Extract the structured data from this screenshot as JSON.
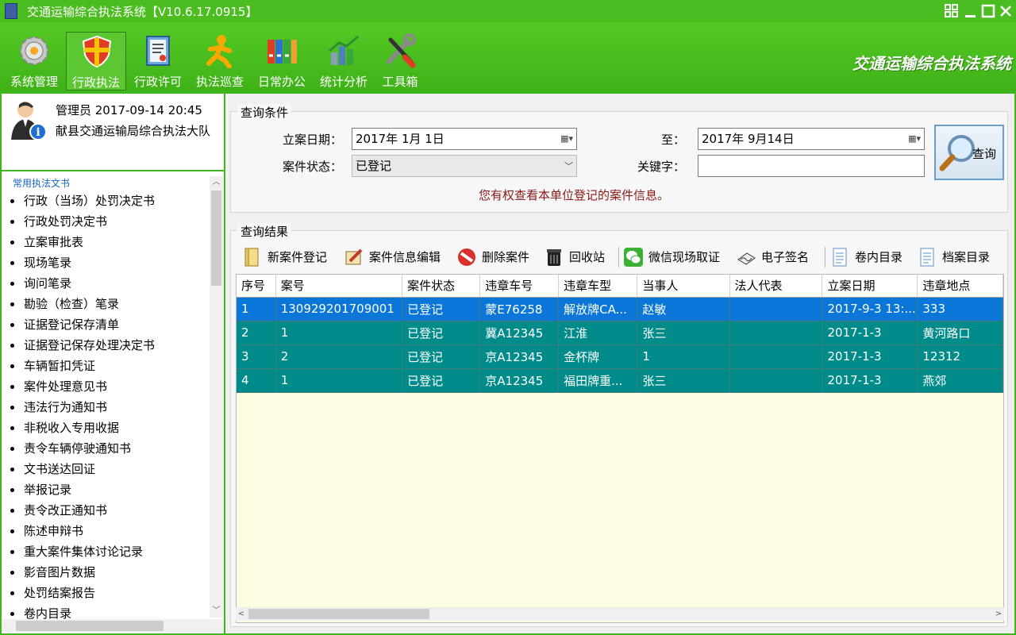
{
  "window": {
    "title": "交通运输综合执法系统【V10.6.17.0915】"
  },
  "ribbon": {
    "brand": "交通运输综合执法系统",
    "items": [
      {
        "label": "系统管理",
        "icon": "gear-icon"
      },
      {
        "label": "行政执法",
        "icon": "shield-icon",
        "active": true
      },
      {
        "label": "行政许可",
        "icon": "document-icon"
      },
      {
        "label": "执法巡查",
        "icon": "runner-icon"
      },
      {
        "label": "日常办公",
        "icon": "binders-icon"
      },
      {
        "label": "统计分析",
        "icon": "chart-icon"
      },
      {
        "label": "工具箱",
        "icon": "tools-icon"
      }
    ]
  },
  "user": {
    "role_datetime": "管理员   2017-09-14 20:45",
    "org": "献县交通运输局综合执法大队"
  },
  "sidebar": {
    "header": "常用执法文书",
    "items": [
      "行政（当场）处罚决定书",
      "行政处罚决定书",
      "立案审批表",
      "现场笔录",
      "询问笔录",
      "勘验（检查）笔录",
      "证据登记保存清单",
      "证据登记保存处理决定书",
      "车辆暂扣凭证",
      "案件处理意见书",
      "违法行为通知书",
      "非税收入专用收据",
      "责令车辆停驶通知书",
      "文书送达回证",
      "举报记录",
      "责令改正通知书",
      "陈述申辩书",
      "重大案件集体讨论记录",
      "影音图片数据",
      "处罚结案报告",
      "卷内目录"
    ]
  },
  "query": {
    "title": "查询条件",
    "date_label": "立案日期：",
    "date_from": "2017年  1月  1日",
    "to_label": "至：",
    "date_to": "2017年  9月14日",
    "status_label": "案件状态：",
    "status_value": "已登记",
    "keyword_label": "关键字：",
    "keyword_value": "",
    "notice": "您有权查看本单位登记的案件信息。",
    "search_label": "查询"
  },
  "results": {
    "title": "查询结果",
    "toolbar": [
      {
        "label": "新案件登记",
        "icon": "folder-icon"
      },
      {
        "label": "案件信息编辑",
        "icon": "edit-icon"
      },
      {
        "label": "删除案件",
        "icon": "delete-icon"
      },
      {
        "label": "回收站",
        "icon": "trash-icon"
      },
      {
        "label": "微信现场取证",
        "icon": "wechat-icon"
      },
      {
        "label": "电子签名",
        "icon": "signature-icon"
      },
      {
        "label": "卷内目录",
        "icon": "doc-list-icon"
      },
      {
        "label": "档案目录",
        "icon": "archive-icon"
      }
    ],
    "columns": [
      "序号",
      "案号",
      "案件状态",
      "违章车号",
      "违章车型",
      "当事人",
      "法人代表",
      "立案日期",
      "违章地点"
    ],
    "rows": [
      [
        "1",
        "130929201709001",
        "已登记",
        "蒙E76258",
        "解放牌CA...",
        "赵敏",
        "",
        "2017-9-3 13:...",
        "333"
      ],
      [
        "2",
        "1",
        "已登记",
        "冀A12345",
        "江淮",
        "张三",
        "",
        "2017-1-3",
        "黄河路口"
      ],
      [
        "3",
        "2",
        "已登记",
        "京A12345",
        "金杯牌",
        "1",
        "",
        "2017-1-3",
        "12312"
      ],
      [
        "4",
        "1",
        "已登记",
        "京A12345",
        "福田牌重...",
        "张三",
        "",
        "2017-1-3",
        "燕郊"
      ]
    ]
  },
  "colors": {
    "green": "#3fb51e",
    "row": "#008b8b",
    "selected": "#0a76d8",
    "grid_bg": "#fdfde2"
  }
}
